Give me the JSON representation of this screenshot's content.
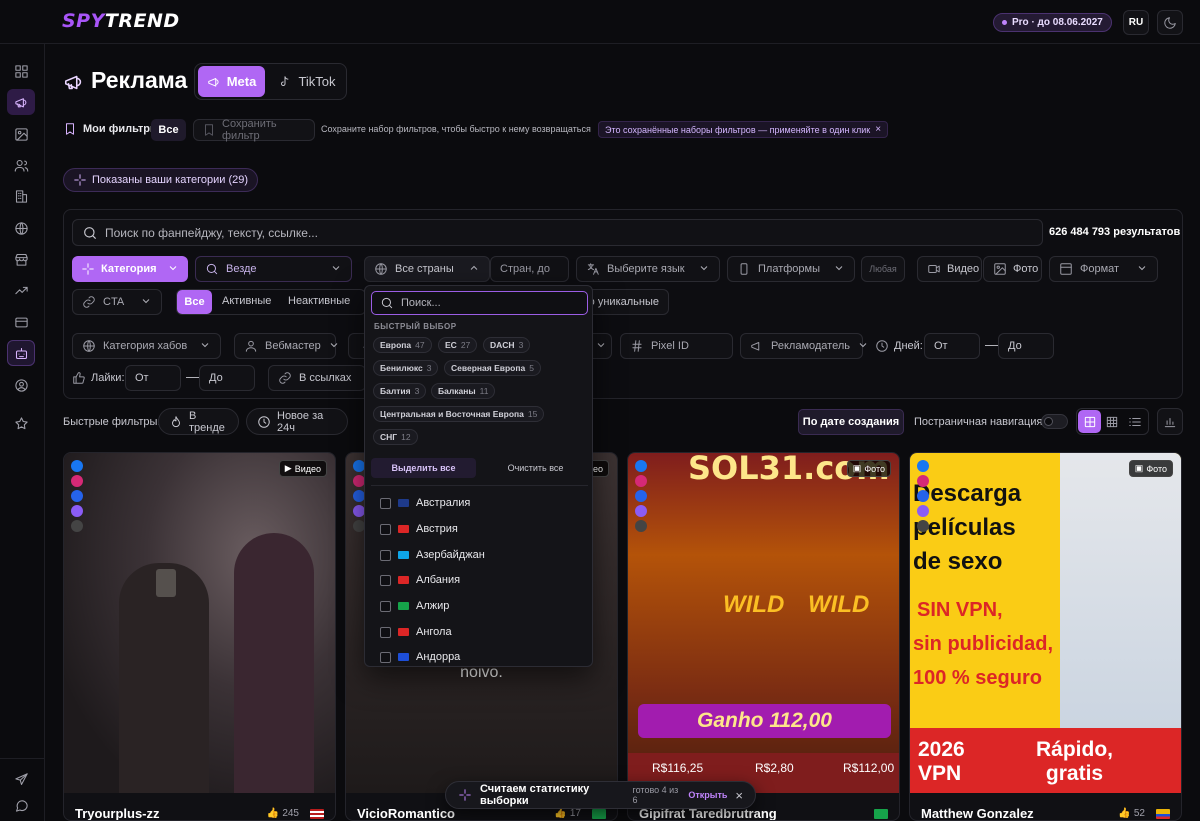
{
  "brand": {
    "logo_a": "SPY",
    "logo_b": "TREND"
  },
  "topbar": {
    "pro": "Pro · до 08.06.2027",
    "lang": "RU"
  },
  "sidebar": [
    "dashboard-icon",
    "megaphone-icon",
    "image-icon",
    "users-icon",
    "building-icon",
    "globe-icon",
    "store-icon",
    "trending-icon",
    "card-icon",
    "robot-icon",
    "user-circle-icon",
    "star-icon",
    "send-icon",
    "chat-icon"
  ],
  "header": {
    "title": "Реклама",
    "tab_meta": "Meta",
    "tab_tiktok": "TikTok"
  },
  "saved": {
    "my_filters": "Мои фильтры",
    "all": "Все",
    "save_filter": "Сохранить фильтр",
    "hint": "Сохраните набор фильтров, чтобы быстро к нему возвращаться",
    "chip": "Это сохранённые наборы фильтров — применяйте в один клик"
  },
  "categories_chip": "Показаны ваши категории (29)",
  "filters": {
    "search_placeholder": "Поиск по фанпейджу, тексту, ссылке...",
    "results": "626 484 793 результатов",
    "category": "Категория",
    "where": "Везде",
    "countries": "Все страны",
    "countries_to": "Стран, до",
    "language": "Выберите язык",
    "platforms": "Платформы",
    "any": "Любая",
    "video": "Видео",
    "photo": "Фото",
    "format": "Формат",
    "cta": "CTA",
    "status_all": "Все",
    "status_active": "Активные",
    "status_inactive": "Неактивные",
    "unique": "о уникальные",
    "hub_category": "Категория хабов",
    "webmaster": "Вебмастер",
    "pixel": "Pixel ID",
    "advertiser": "Рекламодатель",
    "days": "Дней:",
    "from": "От",
    "to": "До",
    "likes": "Лайки:",
    "in_links": "В ссылках"
  },
  "quick": {
    "label": "Быстрые фильтры:",
    "trend": "В тренде",
    "new24": "Новое за 24ч"
  },
  "toolbar": {
    "sort": "По дате создания",
    "paging": "Постраничная навигация"
  },
  "country_dropdown": {
    "search_placeholder": "Поиск...",
    "quick_label": "БЫСТРЫЙ ВЫБОР",
    "chips": [
      {
        "name": "Европа",
        "count": "47"
      },
      {
        "name": "ЕС",
        "count": "27"
      },
      {
        "name": "DACH",
        "count": "3"
      },
      {
        "name": "Бенилюкс",
        "count": "3"
      },
      {
        "name": "Северная Европа",
        "count": "5"
      },
      {
        "name": "Балтия",
        "count": "3"
      },
      {
        "name": "Балканы",
        "count": "11"
      },
      {
        "name": "Центральная и Восточная Европа",
        "count": "15"
      },
      {
        "name": "СНГ",
        "count": "12"
      }
    ],
    "select_all": "Выделить все",
    "clear_all": "Очистить все",
    "countries": [
      "Австралия",
      "Австрия",
      "Азербайджан",
      "Албания",
      "Алжир",
      "Ангола",
      "Андорра"
    ],
    "flag_colors": [
      "#1e3a8a",
      "#dc2626",
      "#0ea5e9",
      "#dc2626",
      "#16a34a",
      "#dc2626",
      "#1d4ed8"
    ]
  },
  "cards": [
    {
      "name": "Tryourplus-zz",
      "likes": "245",
      "kind": "Видео",
      "flag": "#3b5bdb"
    },
    {
      "name": "VicioRomantico",
      "likes": "17",
      "kind": "Видео",
      "flag": "#16a34a",
      "caption": "Milionário, e também seu falso noivo."
    },
    {
      "name": "Gipifrat Taredbrutrang",
      "likes": "",
      "kind": "Фото",
      "flag": "#16a34a",
      "art": {
        "top": "SOL31.com",
        "wild": "WILD",
        "win": "Ganho 112,00",
        "v1": "R$116,25",
        "v2": "R$2,80",
        "v3": "R$112,00"
      }
    },
    {
      "name": "Matthew Gonzalez",
      "likes": "52",
      "kind": "Фото",
      "flag": "#eab308",
      "art": {
        "l1": "Descarga",
        "l2": "películas",
        "l3": "de sexo",
        "l4": "SIN VPN,",
        "l5": "sin publicidad,",
        "l6": "100 % seguro",
        "b1": "2026",
        "b2": "VPN",
        "b3": "Rápido,",
        "b4": "gratis"
      }
    }
  ],
  "toast": {
    "text": "Считаем статистику выборки",
    "progress": "готово 4 из 6",
    "open": "Открыть"
  }
}
